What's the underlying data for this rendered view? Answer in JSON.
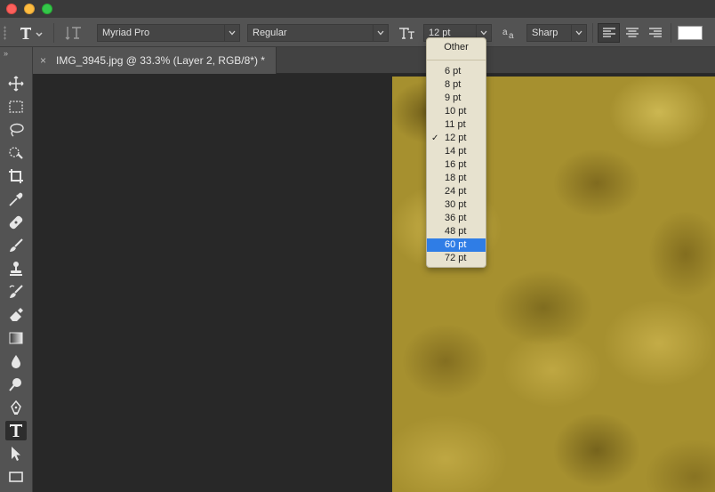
{
  "options_bar": {
    "font_family": "Myriad Pro",
    "font_style": "Regular",
    "font_size": "12 pt",
    "antialias": "Sharp",
    "text_color": "#ffffff"
  },
  "document_tab": {
    "close_glyph": "×",
    "title": "IMG_3945.jpg @ 33.3% (Layer 2, RGB/8*) *"
  },
  "font_size_menu": {
    "other_label": "Other",
    "checked_item": "12 pt",
    "highlighted_item": "60 pt",
    "items": [
      "6 pt",
      "8 pt",
      "9 pt",
      "10 pt",
      "11 pt",
      "12 pt",
      "14 pt",
      "16 pt",
      "18 pt",
      "24 pt",
      "30 pt",
      "36 pt",
      "48 pt",
      "60 pt",
      "72 pt"
    ],
    "highlight_color": "#2f7de6"
  },
  "toolbar": {
    "collapse_glyph": "»",
    "tools": [
      "move-tool",
      "marquee-tool",
      "lasso-tool",
      "quick-selection-tool",
      "crop-tool",
      "eyedropper-tool",
      "healing-brush-tool",
      "brush-tool",
      "clone-stamp-tool",
      "history-brush-tool",
      "eraser-tool",
      "gradient-tool",
      "blur-tool",
      "dodge-tool",
      "pen-tool",
      "type-tool",
      "path-selection-tool",
      "rectangle-tool"
    ],
    "active_tool": "type-tool"
  },
  "canvas": {
    "texture": "gold-foil",
    "base_color": "#a6902f"
  }
}
